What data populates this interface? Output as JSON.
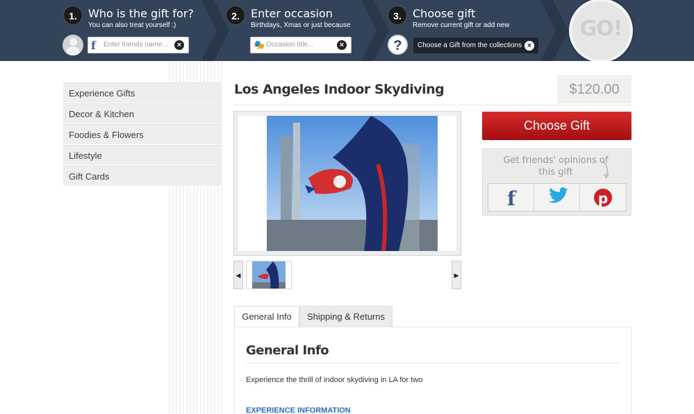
{
  "wizard": {
    "steps": [
      {
        "number": "1.",
        "title": "Who is the gift for?",
        "subtitle": "You can also treat yourself :)",
        "placeholder": "Enter friends name..."
      },
      {
        "number": "2.",
        "title": "Enter occasion",
        "subtitle": "Birthdays, Xmas or just because",
        "placeholder": "Occasion title..."
      },
      {
        "number": "3.",
        "title": "Choose gift",
        "subtitle": "Remove current gift or add new",
        "action_label": "Choose a Gift from the collections"
      }
    ],
    "clear_glyph": "×",
    "help_glyph": "?",
    "go_label": "GO!",
    "facebook_glyph": "f",
    "mask_glyph": "🎭"
  },
  "sidebar": {
    "items": [
      {
        "label": "Experience Gifts"
      },
      {
        "label": "Decor & Kitchen"
      },
      {
        "label": "Foodies & Flowers"
      },
      {
        "label": "Lifestyle"
      },
      {
        "label": "Gift Cards"
      }
    ]
  },
  "product": {
    "title": "Los Angeles Indoor Skydiving",
    "price": "$120.00",
    "choose_label": "Choose Gift",
    "share_text": "Get friends' opinions of this gift",
    "prev_glyph": "◀",
    "next_glyph": "▶"
  },
  "tabs": [
    {
      "label": "General Info"
    },
    {
      "label": "Shipping & Returns"
    }
  ],
  "panel": {
    "title": "General Info",
    "description": "Experience the thrill of indoor skydiving in LA for two",
    "subheading": "EXPERIENCE INFORMATION"
  },
  "colors": {
    "topbar": "#33435a",
    "accent_red": "#c41e22",
    "facebook": "#3b5998",
    "twitter": "#2aa9e0",
    "pinterest": "#cb2027"
  }
}
